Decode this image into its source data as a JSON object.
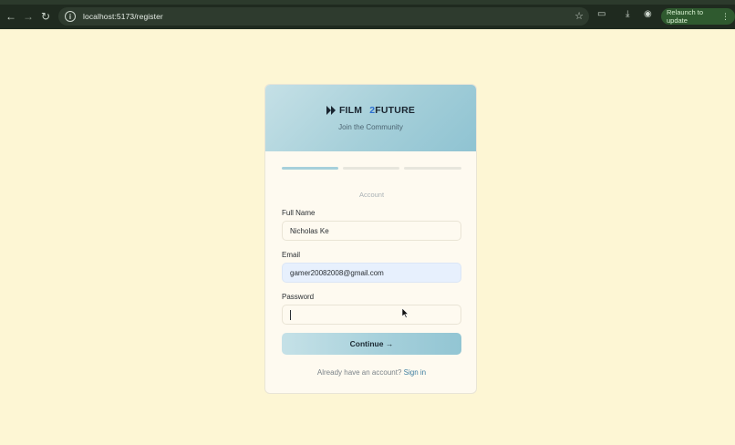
{
  "browser": {
    "url": "localhost:5173/register",
    "relaunch_label": "Relaunch to update"
  },
  "brand": {
    "name_part1": "FILM",
    "name_part2": "2",
    "name_part3": "FUTURE",
    "tagline": "Join the Community",
    "accent_color": "#2d6fd1"
  },
  "progress": {
    "total_steps": 3,
    "current_step": 1
  },
  "form": {
    "step_title": "Account",
    "full_name": {
      "label": "Full Name",
      "value": "Nicholas Ke"
    },
    "email": {
      "label": "Email",
      "value": "gamer20082008@gmail.com"
    },
    "password": {
      "label": "Password",
      "value": ""
    },
    "continue_label": "Continue →"
  },
  "footer": {
    "prompt": "Already have an account?",
    "link": "Sign in"
  }
}
